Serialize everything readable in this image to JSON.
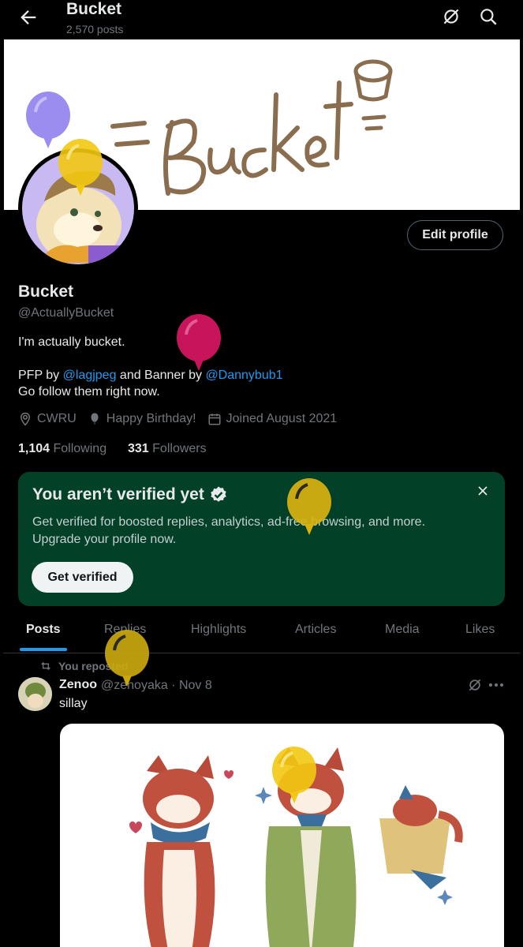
{
  "header": {
    "title": "Bucket",
    "post_count": "2,570 posts"
  },
  "banner": {
    "icon": "bucket-banner-art"
  },
  "profile": {
    "edit_label": "Edit profile",
    "name": "Bucket",
    "handle": "@ActuallyBucket",
    "bio_line1": "I'm actually bucket.",
    "bio_pfp_prefix": "PFP by ",
    "bio_pfp_link": "@lagjpeg",
    "bio_banner_mid": " and Banner by ",
    "bio_banner_link": "@Dannybub1",
    "bio_line3": "Go follow them right now.",
    "location": "CWRU",
    "birthday": "Happy Birthday!",
    "joined": "Joined August 2021",
    "following_count": "1,104",
    "following_label": "Following",
    "followers_count": "331",
    "followers_label": "Followers"
  },
  "verify_card": {
    "title": "You aren’t verified yet",
    "description": "Get verified for boosted replies, analytics, ad-free browsing, and more. Upgrade your profile now.",
    "button": "Get verified"
  },
  "tabs": [
    {
      "label": "Posts",
      "active": true
    },
    {
      "label": "Replies"
    },
    {
      "label": "Highlights"
    },
    {
      "label": "Articles"
    },
    {
      "label": "Media"
    },
    {
      "label": "Likes"
    }
  ],
  "post": {
    "repost_label": "You reposted",
    "author": "Zenoo",
    "handle_date": "@zenoyaka · Nov 8",
    "text": "sillay"
  },
  "colors": {
    "accent": "#1d9bf0",
    "verify_bg": "#024127",
    "balloon_purple": "#9b8cf0",
    "balloon_yellow": "#f2c811",
    "balloon_magenta": "#c8145a"
  }
}
